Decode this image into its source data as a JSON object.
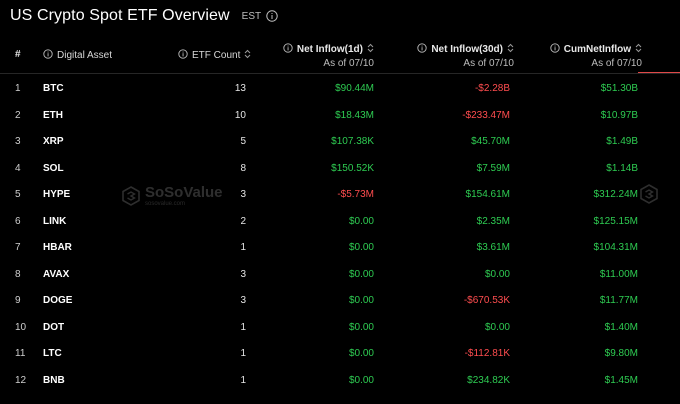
{
  "header": {
    "title": "US Crypto Spot ETF Overview",
    "timezone": "EST"
  },
  "columns": {
    "index": "#",
    "asset": "Digital Asset",
    "count": "ETF Count",
    "net_1d": "Net Inflow(1d)",
    "net_1d_sub": "As of 07/10",
    "net_30d": "Net Inflow(30d)",
    "net_30d_sub": "As of 07/10",
    "cum": "CumNetInflow",
    "cum_sub": "As of 07/10"
  },
  "rows": [
    {
      "idx": "1",
      "asset": "BTC",
      "count": "13",
      "net_1d": "$90.44M",
      "net_30d": "-$2.28B",
      "cum": "$51.30B"
    },
    {
      "idx": "2",
      "asset": "ETH",
      "count": "10",
      "net_1d": "$18.43M",
      "net_30d": "-$233.47M",
      "cum": "$10.97B"
    },
    {
      "idx": "3",
      "asset": "XRP",
      "count": "5",
      "net_1d": "$107.38K",
      "net_30d": "$45.70M",
      "cum": "$1.49B"
    },
    {
      "idx": "4",
      "asset": "SOL",
      "count": "8",
      "net_1d": "$150.52K",
      "net_30d": "$7.59M",
      "cum": "$1.14B"
    },
    {
      "idx": "5",
      "asset": "HYPE",
      "count": "3",
      "net_1d": "-$5.73M",
      "net_30d": "$154.61M",
      "cum": "$312.24M"
    },
    {
      "idx": "6",
      "asset": "LINK",
      "count": "2",
      "net_1d": "$0.00",
      "net_30d": "$2.35M",
      "cum": "$125.15M"
    },
    {
      "idx": "7",
      "asset": "HBAR",
      "count": "1",
      "net_1d": "$0.00",
      "net_30d": "$3.61M",
      "cum": "$104.31M"
    },
    {
      "idx": "8",
      "asset": "AVAX",
      "count": "3",
      "net_1d": "$0.00",
      "net_30d": "$0.00",
      "cum": "$11.00M"
    },
    {
      "idx": "9",
      "asset": "DOGE",
      "count": "3",
      "net_1d": "$0.00",
      "net_30d": "-$670.53K",
      "cum": "$11.77M"
    },
    {
      "idx": "10",
      "asset": "DOT",
      "count": "1",
      "net_1d": "$0.00",
      "net_30d": "$0.00",
      "cum": "$1.40M"
    },
    {
      "idx": "11",
      "asset": "LTC",
      "count": "1",
      "net_1d": "$0.00",
      "net_30d": "-$112.81K",
      "cum": "$9.80M"
    },
    {
      "idx": "12",
      "asset": "BNB",
      "count": "1",
      "net_1d": "$0.00",
      "net_30d": "$234.82K",
      "cum": "$1.45M"
    }
  ],
  "watermark": {
    "main": "SoSoValue",
    "sub": "sosovalue.com"
  },
  "colors": {
    "positive": "#2ecc52",
    "negative": "#ff4d4f",
    "accent": "#e04848",
    "background": "#000000"
  }
}
